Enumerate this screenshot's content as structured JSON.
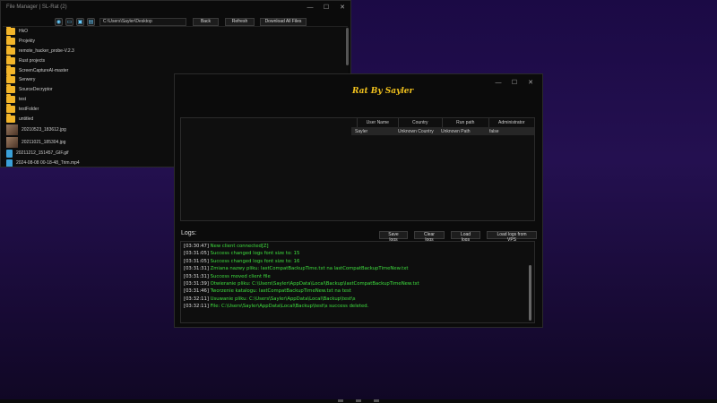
{
  "file_manager": {
    "title": "File Manager | SL-Rat (2)",
    "path_value": "C:\\Users\\Sayler\\Desktop",
    "back_label": "Back",
    "refresh_label": "Refresh",
    "download_label": "Download All Files",
    "items": [
      {
        "name": "HkO",
        "type": "folder"
      },
      {
        "name": "Projekty",
        "type": "folder"
      },
      {
        "name": "remote_hacker_probe-V.2.3",
        "type": "folder"
      },
      {
        "name": "Rust projects",
        "type": "folder"
      },
      {
        "name": "ScreenCaptureAI-master",
        "type": "folder"
      },
      {
        "name": "Serwery",
        "type": "folder"
      },
      {
        "name": "SourceDecryptor",
        "type": "folder"
      },
      {
        "name": "test",
        "type": "folder"
      },
      {
        "name": "testFolder",
        "type": "folder"
      },
      {
        "name": "untitled",
        "type": "folder"
      },
      {
        "name": "20210523_183612.jpg",
        "type": "image"
      },
      {
        "name": "20211021_185304.jpg",
        "type": "image"
      },
      {
        "name": "20211212_151457_GIF.gif",
        "type": "file"
      },
      {
        "name": "2024-08-08 00-18-48_Trim.mp4",
        "type": "file"
      }
    ]
  },
  "rat": {
    "title_text": "Rat By Sayler",
    "columns": [
      "User Name",
      "Country",
      "Run path",
      "Administrator"
    ],
    "row": {
      "user": "Sayler",
      "country": "Unknown Country",
      "run_path": "Unknown Path",
      "admin": "false"
    },
    "logs_label": "Logs:",
    "buttons": {
      "save": "Save logs",
      "clear": "Clear logs",
      "load": "Load logs",
      "load_vps": "Load logs from VPS"
    },
    "logs": [
      {
        "ts": "[03:30:47]",
        "msg": "New client connected[Z]"
      },
      {
        "ts": "[03:31:05]",
        "msg": "Success changed logs font size to: 15"
      },
      {
        "ts": "[03:31:05]",
        "msg": "Success changed logs font size to: 16"
      },
      {
        "ts": "[03:31:31]",
        "msg": "Zmiana nazwy pliku: lastCompatBackupTime.txt na lastCompatBackupTimeNew.txt"
      },
      {
        "ts": "[03:31:31]",
        "msg": "Success moved client file"
      },
      {
        "ts": "[03:31:39]",
        "msg": "Otwieranie pliku: C:\\Users\\Sayler\\AppData\\Local\\Backup\\lastCompatBackupTimeNew.txt"
      },
      {
        "ts": "[03:31:46]",
        "msg": "Tworzenie katalogu: lastCompatBackupTimeNew.txt na test"
      },
      {
        "ts": "[03:32:11]",
        "msg": "Usuwanie pliku: C:\\Users\\Sayler\\AppData\\Local\\Backup\\test\\s"
      },
      {
        "ts": "[03:32:11]",
        "msg": "File: C:\\Users\\Sayler\\AppData\\Local\\Backup\\test\\s success deleted."
      }
    ]
  },
  "colors": {
    "accent_title": "#f2c21d",
    "log_text": "#3fe03f",
    "folder": "#f2b52a",
    "desktop_bg": "#1b0a45"
  },
  "icons": [
    "screenshot-icon",
    "monitor-icon",
    "device-icon",
    "document-icon"
  ]
}
